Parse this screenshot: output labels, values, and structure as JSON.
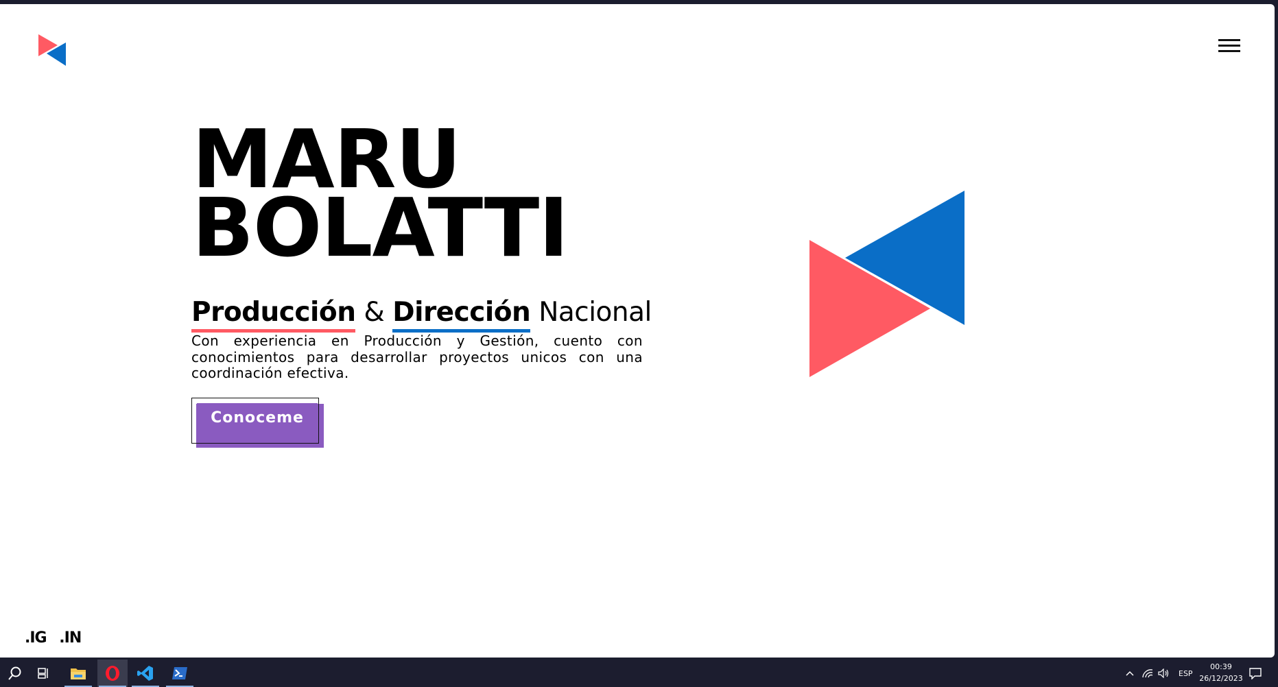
{
  "hero": {
    "name_line1": "MARU",
    "name_line2": "BOLATTI",
    "subtitle_word1": "Producción",
    "subtitle_amp": "&",
    "subtitle_word2": "Dirección",
    "subtitle_word3": "Nacional",
    "description": "Con experiencia en Producción y Gestión, cuento con conocimientos para desarrollar proyectos unicos con una coordinación efectiva.",
    "cta_label": "Conoceme"
  },
  "social": {
    "ig": ".IG",
    "in": ".IN"
  },
  "colors": {
    "red": "#ff5a63",
    "blue": "#0a6ec7",
    "purple": "#8a5bc0"
  },
  "taskbar": {
    "language": "ESP",
    "time": "00:39",
    "date": "26/12/2023",
    "apps": [
      "search-icon",
      "task-view-icon",
      "file-explorer-icon",
      "opera-icon",
      "vscode-icon",
      "powershell-icon"
    ]
  }
}
